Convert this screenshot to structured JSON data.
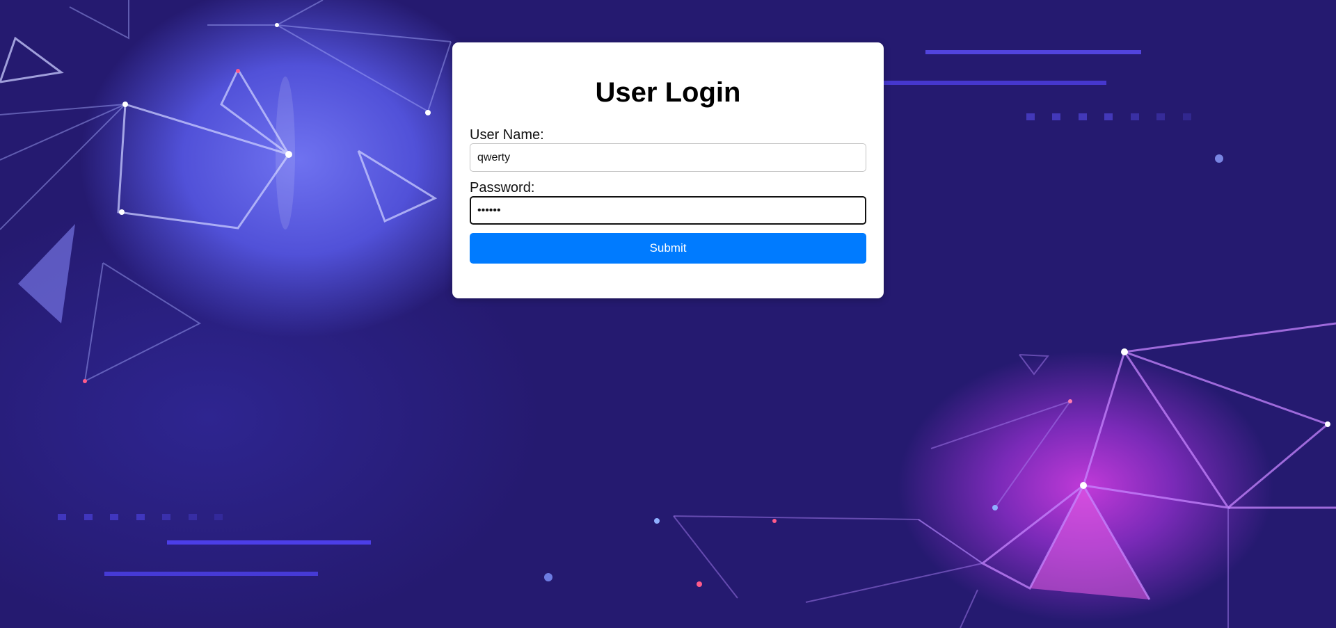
{
  "login": {
    "title": "User Login",
    "username_label": "User Name:",
    "username_value": "qwerty",
    "password_label": "Password:",
    "password_value": "qwerty",
    "submit_label": "Submit"
  },
  "colors": {
    "background": "#251a70",
    "card": "#ffffff",
    "submit": "#007bff",
    "glow_blue": "#6f72f0",
    "glow_pink": "#e040e0"
  }
}
